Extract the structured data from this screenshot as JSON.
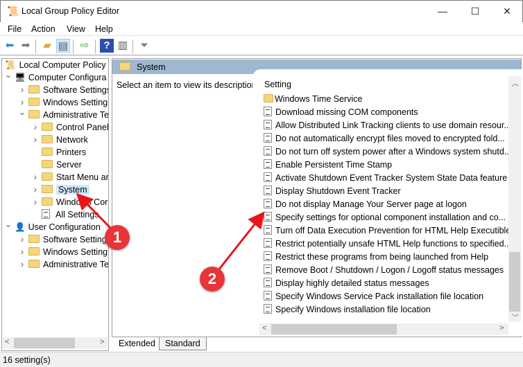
{
  "window": {
    "title": "Local Group Policy Editor",
    "minimize": "—",
    "maximize": "☐",
    "close": "✕"
  },
  "menu": [
    "File",
    "Action",
    "View",
    "Help"
  ],
  "toolbar": [
    "back-icon",
    "forward-icon",
    "up-folder-icon",
    "show-hide-tree-icon",
    "export-list-icon",
    "help-icon",
    "show-action-pane-icon",
    "filter-icon"
  ],
  "tree": {
    "root": "Local Computer Policy",
    "nodes": [
      {
        "label": "Computer Configura",
        "level": 1,
        "expanded": true
      },
      {
        "label": "Software Settings",
        "level": 2
      },
      {
        "label": "Windows Settings",
        "level": 2
      },
      {
        "label": "Administrative Te",
        "level": 2,
        "expanded": true
      },
      {
        "label": "Control Panel",
        "level": 3
      },
      {
        "label": "Network",
        "level": 3
      },
      {
        "label": "Printers",
        "level": 3,
        "leaf": true
      },
      {
        "label": "Server",
        "level": 3,
        "leaf": true
      },
      {
        "label": "Start Menu ar",
        "level": 3
      },
      {
        "label": "System",
        "level": 3,
        "selected": true
      },
      {
        "label": "Windows Cor",
        "level": 3
      },
      {
        "label": "All Settings",
        "level": 3,
        "leaf": true,
        "icon": "all-settings"
      },
      {
        "label": "User Configuration",
        "level": 1,
        "expanded": true
      },
      {
        "label": "Software Setting",
        "level": 2
      },
      {
        "label": "Windows Setting",
        "level": 2
      },
      {
        "label": "Administrative Te",
        "level": 2
      }
    ]
  },
  "right": {
    "header": "System",
    "description": "Select an item to view its description.",
    "column": "Setting",
    "settings": [
      {
        "label": "Windows Time Service",
        "type": "folder"
      },
      {
        "label": "Download missing COM components"
      },
      {
        "label": "Allow Distributed Link Tracking clients to use domain resour..."
      },
      {
        "label": "Do not automatically encrypt files moved to encrypted fold..."
      },
      {
        "label": "Do not turn off system power after a Windows system shutd..."
      },
      {
        "label": "Enable Persistent Time Stamp"
      },
      {
        "label": "Activate Shutdown Event Tracker System State Data feature"
      },
      {
        "label": "Display Shutdown Event Tracker"
      },
      {
        "label": "Do not display Manage Your Server page at logon"
      },
      {
        "label": "Specify settings for optional component installation and co..."
      },
      {
        "label": "Turn off Data Execution Prevention for HTML Help Executible"
      },
      {
        "label": "Restrict potentially unsafe HTML Help functions to specified..."
      },
      {
        "label": "Restrict these programs from being launched from Help"
      },
      {
        "label": "Remove Boot / Shutdown / Logon / Logoff status messages"
      },
      {
        "label": "Display highly detailed status messages"
      },
      {
        "label": "Specify Windows Service Pack installation file location"
      },
      {
        "label": "Specify Windows installation file location"
      }
    ]
  },
  "tabs": [
    "Extended",
    "Standard"
  ],
  "status": "16 setting(s)",
  "annotations": [
    "1",
    "2"
  ],
  "colors": {
    "header": "#9fb7d1",
    "selection": "#cce8ff",
    "badge": "#e8353a"
  }
}
